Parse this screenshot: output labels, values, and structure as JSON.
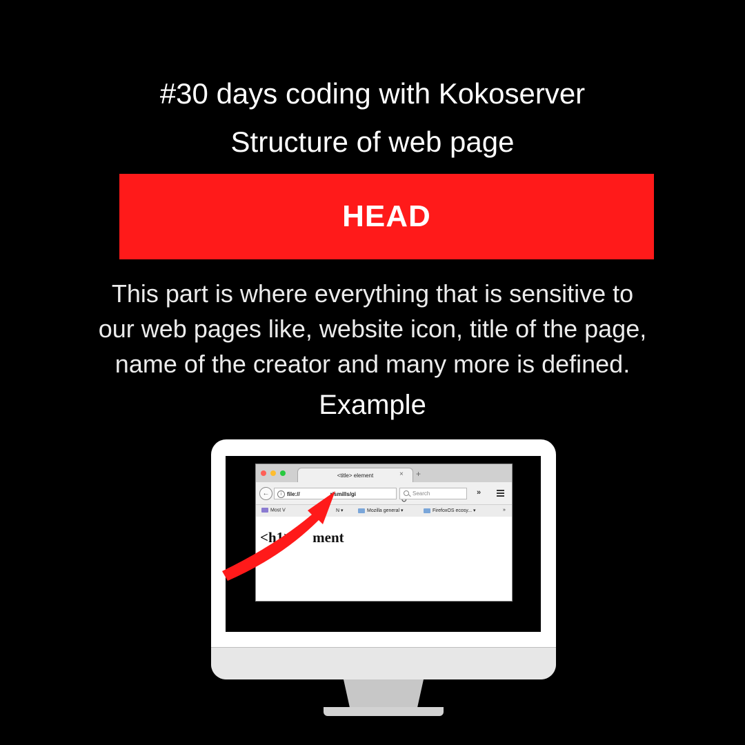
{
  "headline": "#30 days coding with Kokoserver",
  "subheadline": "Structure of  web page",
  "banner_label": "HEAD",
  "description": "This part  is where everything that is sensitive to our web pages like, website icon, title of the page, name of the creator and many more is defined.",
  "example_label": "Example",
  "colors": {
    "background": "#000000",
    "accent": "#ff1a1a",
    "text": "#ffffff"
  },
  "browser": {
    "tab_title": "<title> element",
    "tab_close": "×",
    "new_tab": "+",
    "url": "file://",
    "url_tail": "rismills/gi",
    "search_placeholder": "Search",
    "bookmarks": [
      "Most V",
      "N",
      "Mozilla general",
      "FirefoxOS ecosy..."
    ],
    "page_heading": "<h1>",
    "page_heading_tail": "ment"
  }
}
